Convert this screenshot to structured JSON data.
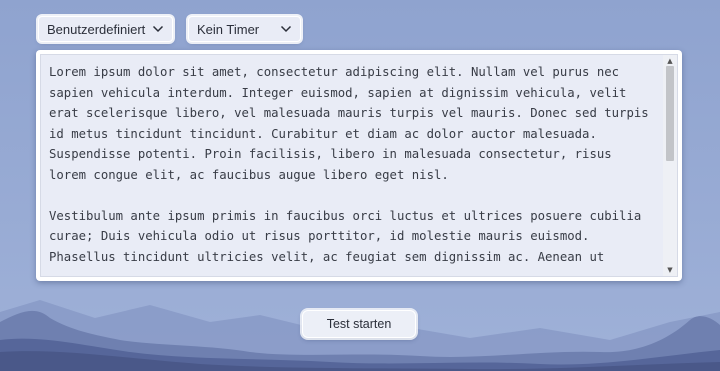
{
  "toolbar": {
    "mode_select": {
      "selected": "Benutzerdefiniert",
      "icon": "chevron-down-icon"
    },
    "timer_select": {
      "selected": "Kein Timer",
      "icon": "chevron-down-icon"
    }
  },
  "editor": {
    "text": "Lorem ipsum dolor sit amet, consectetur adipiscing elit. Nullam vel purus nec sapien vehicula interdum. Integer euismod, sapien at dignissim vehicula, velit erat scelerisque libero, vel malesuada mauris turpis vel mauris. Donec sed turpis id metus tincidunt tincidunt. Curabitur et diam ac dolor auctor malesuada. Suspendisse potenti. Proin facilisis, libero in malesuada consectetur, risus lorem congue elit, ac faucibus augue libero eget nisl.\n\nVestibulum ante ipsum primis in faucibus orci luctus et ultrices posuere cubilia curae; Duis vehicula odio ut risus porttitor, id molestie mauris euismod. Phasellus tincidunt ultricies velit, ac feugiat sem dignissim ac. Aenean ut",
    "scroll_up_icon": "triangle-up-icon",
    "scroll_down_icon": "triangle-down-icon"
  },
  "actions": {
    "start_label": "Test starten"
  },
  "colors": {
    "background": "#93a6d0",
    "mountains_far": "#7f93bf",
    "mountains_near": "#5a6a95",
    "panel": "#e9ecf6"
  }
}
